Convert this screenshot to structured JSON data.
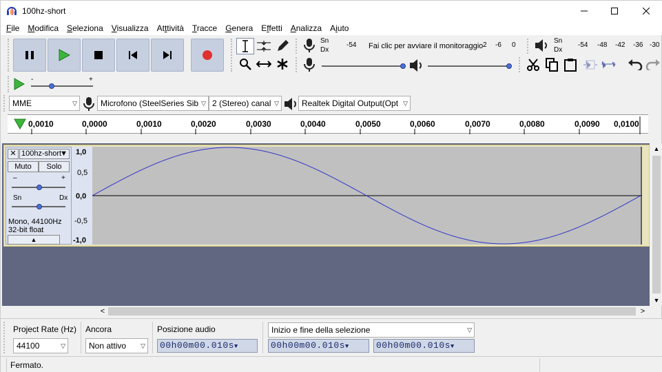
{
  "window": {
    "title": "100hz-short",
    "minimize": "—",
    "maximize": "☐",
    "close": "✕"
  },
  "menu": [
    {
      "label": "File",
      "u": "F",
      "rest": "ile"
    },
    {
      "label": "Modifica",
      "u": "M",
      "rest": "odifica"
    },
    {
      "label": "Seleziona",
      "u": "S",
      "rest": "eleziona"
    },
    {
      "label": "Visualizza",
      "u": "V",
      "rest": "isualizza"
    },
    {
      "label": "Attività",
      "u": "t",
      "pre": "At",
      "rest": "tività"
    },
    {
      "label": "Tracce",
      "u": "T",
      "rest": "racce"
    },
    {
      "label": "Genera",
      "u": "G",
      "rest": "enera"
    },
    {
      "label": "Effetti",
      "u": "f",
      "pre": "E",
      "rest": "fetti"
    },
    {
      "label": "Analizza",
      "u": "A",
      "rest": "nalizza"
    },
    {
      "label": "Aiuto",
      "u": "i",
      "pre": "A",
      "rest": "uto"
    }
  ],
  "meters": {
    "record_lr": [
      "Sn",
      "Dx"
    ],
    "record_scale": [
      "-54",
      "2",
      "-6",
      "0"
    ],
    "record_prompt": "Fai clic per avviare il monitoraggio",
    "play_lr": [
      "Sn",
      "Dx"
    ],
    "play_scale": [
      "-54",
      "-48",
      "-42",
      "-36",
      "-30"
    ]
  },
  "playat_speed": {
    "minus": "-",
    "plus": "+"
  },
  "device": {
    "host": "MME",
    "input": "Microfono (SteelSeries Sib",
    "channels": "2 (Stereo) canal",
    "output": "Realtek Digital Output(Opt"
  },
  "timeline": {
    "ticks": [
      "0,0010",
      "0,0000",
      "0,0010",
      "0,0020",
      "0,0030",
      "0,0040",
      "0,0050",
      "0,0060",
      "0,0070",
      "0,0080",
      "0,0090",
      "0,0100"
    ]
  },
  "track": {
    "name": "100hz-short",
    "mute": "Muto",
    "solo": "Solo",
    "gain_minus": "–",
    "gain_plus": "+",
    "pan_left": "Sn",
    "pan_right": "Dx",
    "info_line1": "Mono, 44100Hz",
    "info_line2": "32-bit float",
    "yaxis": [
      "1,0",
      "0,5",
      "0,0",
      "-0,5",
      "-1,0"
    ]
  },
  "selection_toolbar": {
    "rate_label": "Project Rate (Hz)",
    "rate_value": "44100",
    "snap_label": "Ancora",
    "snap_value": "Non attivo",
    "audio_pos_label": "Posizione audio",
    "audio_pos_value": "00h00m00.010s",
    "sel_mode": "Inizio e fine della selezione",
    "sel_start": "00h00m00.010s",
    "sel_end": "00h00m00.010s"
  },
  "status": {
    "text": "Fermato."
  }
}
